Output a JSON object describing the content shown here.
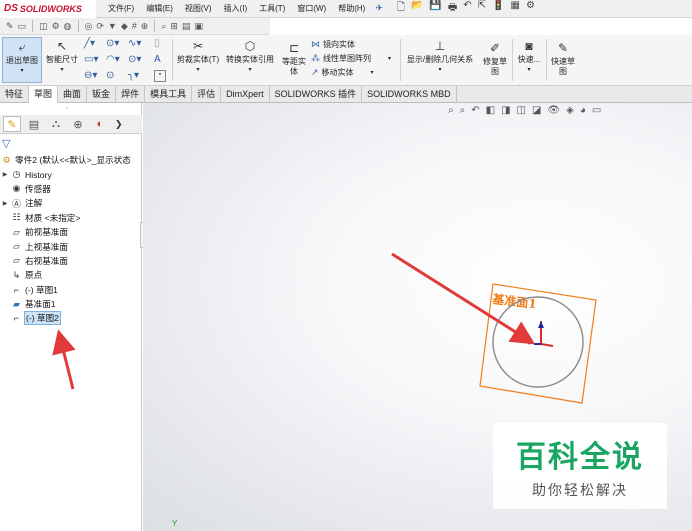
{
  "app": {
    "logo_ds": "DS",
    "logo_name": "SOLIDWORKS"
  },
  "menu": [
    "文件(F)",
    "编辑(E)",
    "视图(V)",
    "插入(I)",
    "工具(T)",
    "窗口(W)",
    "帮助(H)"
  ],
  "ribbon": {
    "exit_sketch": "退出草图",
    "smart_dimension": "智能尺寸",
    "trim": "剪裁实体(T)",
    "convert": "转换实体引用",
    "offset_line1": "等距实",
    "offset_line2": "体",
    "mirror": "镜向实体",
    "linear_pattern": "线性草图阵列",
    "move": "移动实体",
    "display_relations": "显示/删除几何关系",
    "repair_line1": "修复草",
    "repair_line2": "图",
    "rapid_snaps": "快速...",
    "rapid_sketch_line1": "快速草",
    "rapid_sketch_line2": "图"
  },
  "tabs": [
    "特征",
    "草图",
    "曲面",
    "钣金",
    "焊件",
    "模具工具",
    "评估",
    "DimXpert",
    "SOLIDWORKS 插件",
    "SOLIDWORKS MBD"
  ],
  "active_tab_index": 1,
  "tree": [
    {
      "label": "零件2 (默认<<默认>_显示状态",
      "icon": "part-icon",
      "expandable": false
    },
    {
      "label": "History",
      "icon": "history-icon",
      "expandable": true
    },
    {
      "label": "传感器",
      "icon": "sensor-icon",
      "expandable": false
    },
    {
      "label": "注解",
      "icon": "annotation-icon",
      "expandable": true
    },
    {
      "label": "材质 <未指定>",
      "icon": "material-icon",
      "expandable": false
    },
    {
      "label": "前视基准面",
      "icon": "plane-icon",
      "expandable": false
    },
    {
      "label": "上视基准面",
      "icon": "plane-icon",
      "expandable": false
    },
    {
      "label": "右视基准面",
      "icon": "plane-icon",
      "expandable": false
    },
    {
      "label": "原点",
      "icon": "origin-icon",
      "expandable": false
    },
    {
      "label": "(-) 草图1",
      "icon": "sketch-icon",
      "expandable": false
    },
    {
      "label": "基准面1",
      "icon": "plane-icon",
      "expandable": false
    },
    {
      "label": "(-) 草图2",
      "icon": "sketch-icon",
      "expandable": false,
      "selected": true
    }
  ],
  "viewport": {
    "plane_label": "基准面1",
    "axis_label": "Y"
  },
  "watermark": {
    "main": "百科全说",
    "sub": "助你轻松解决"
  },
  "colors": {
    "accent_red": "#e03a3a",
    "plane_orange": "#f07d1a",
    "selection_blue": "#cde3f7",
    "watermark_green": "#1aa562"
  }
}
